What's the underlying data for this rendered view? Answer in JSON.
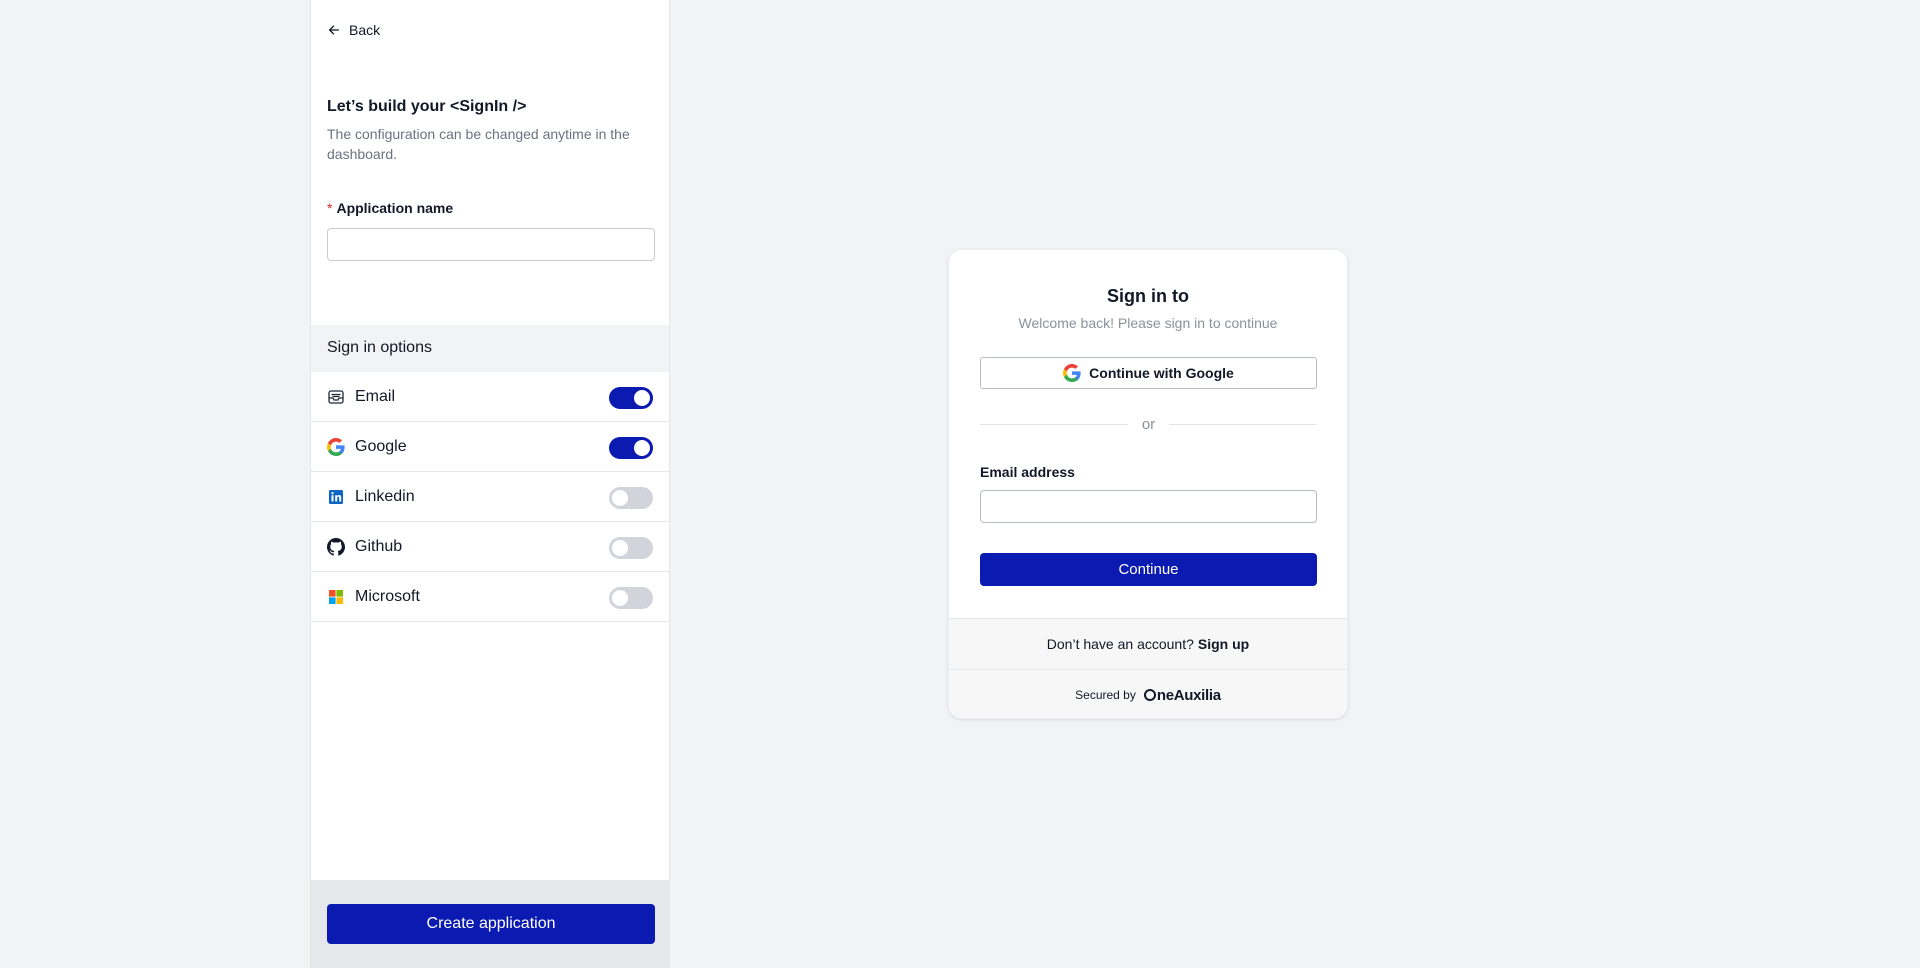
{
  "config_panel": {
    "back_label": "Back",
    "title": "Let’s build your <SignIn />",
    "description": "The configuration can be changed anytime in the dashboard.",
    "app_name_label": "Application name",
    "app_name_required_marker": "*",
    "app_name_value": "",
    "sign_in_options_header": "Sign in options",
    "options": [
      {
        "label": "Email",
        "icon": "email-inbox-icon",
        "enabled": true
      },
      {
        "label": "Google",
        "icon": "google-icon",
        "enabled": true
      },
      {
        "label": "Linkedin",
        "icon": "linkedin-icon",
        "enabled": false
      },
      {
        "label": "Github",
        "icon": "github-icon",
        "enabled": false
      },
      {
        "label": "Microsoft",
        "icon": "microsoft-icon",
        "enabled": false
      }
    ],
    "create_button_label": "Create application"
  },
  "signin_preview": {
    "title": "Sign in to",
    "subtitle": "Welcome back! Please sign in to continue",
    "google_button_label": "Continue with Google",
    "divider_text": "or",
    "email_label": "Email address",
    "email_value": "",
    "continue_button_label": "Continue",
    "no_account_text": "Don’t have an account?",
    "signup_link": "Sign up",
    "secured_by_text": "Secured by",
    "brand_name": "neAuxilia"
  },
  "colors": {
    "accent": "#0b1ab0",
    "background": "#f2f3f5",
    "toggle_off": "#d1d5db"
  }
}
